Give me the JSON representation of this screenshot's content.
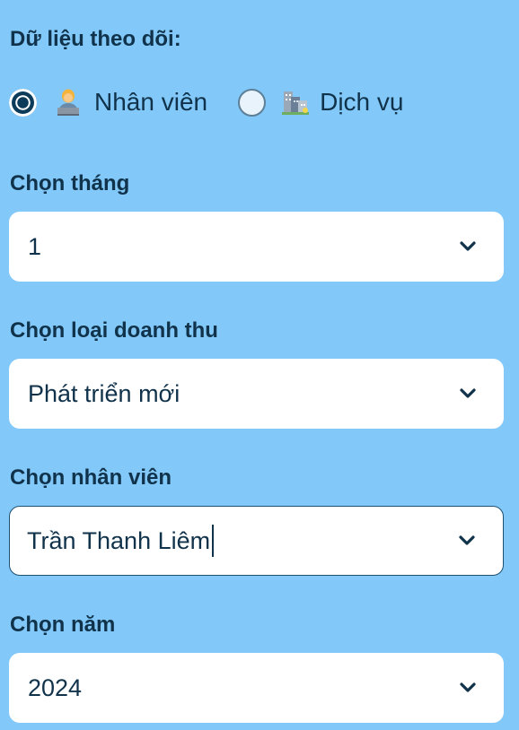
{
  "tracking": {
    "label": "Dữ liệu theo dõi:",
    "options": [
      {
        "label": "Nhân viên",
        "icon": "office-worker-icon",
        "checked": true
      },
      {
        "label": "Dịch vụ",
        "icon": "buildings-icon",
        "checked": false
      }
    ]
  },
  "month": {
    "label": "Chọn tháng",
    "value": "1"
  },
  "revenue_type": {
    "label": "Chọn loại doanh thu",
    "value": "Phát triển mới"
  },
  "employee": {
    "label": "Chọn nhân viên",
    "value": "Trần Thanh Liêm"
  },
  "year": {
    "label": "Chọn năm",
    "value": "2024"
  },
  "colors": {
    "background": "#82c8f8",
    "text": "#10324a",
    "field": "#ffffff",
    "radio_selected": "#0d3b5a"
  }
}
